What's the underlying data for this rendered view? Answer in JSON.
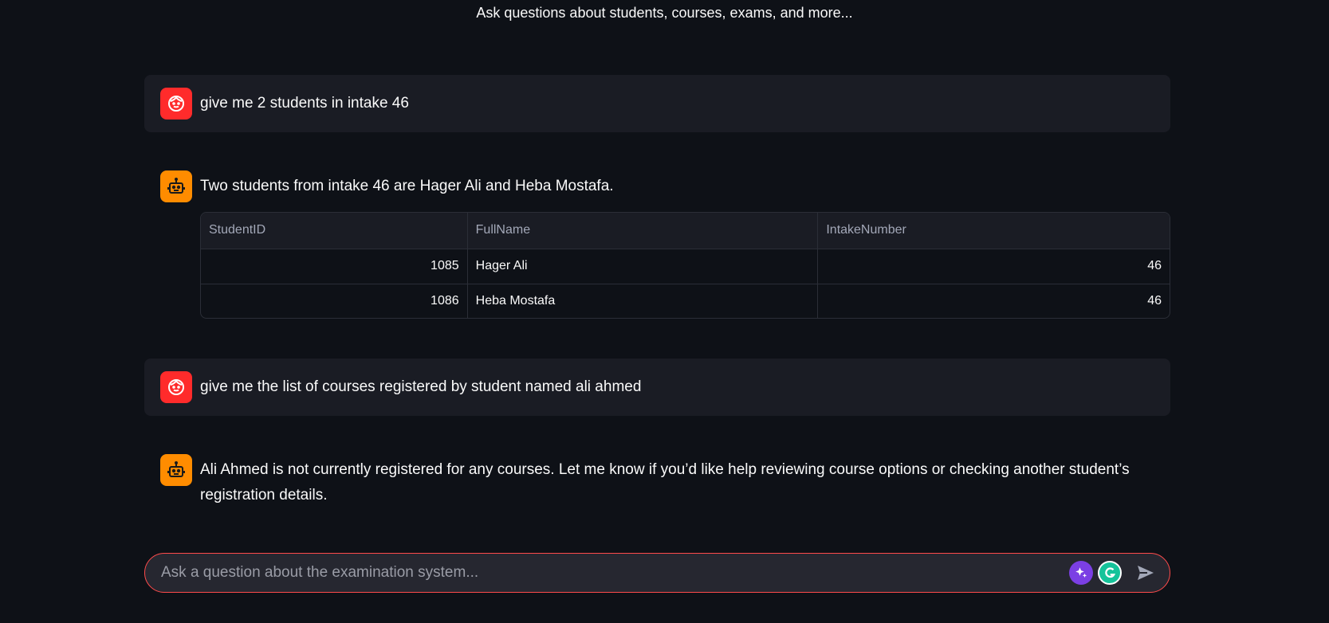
{
  "header": {
    "subtitle": "Ask questions about students, courses, exams, and more..."
  },
  "messages": [
    {
      "role": "user",
      "text": "give me 2 students in intake 46"
    },
    {
      "role": "assistant",
      "text": "Two students from intake 46 are Hager Ali and Heba Mostafa."
    },
    {
      "role": "user",
      "text": "give me the list of courses registered by student named ali ahmed"
    },
    {
      "role": "assistant",
      "text": "Ali Ahmed is not currently registered for any courses. Let me know if you’d like help reviewing course options or checking another student’s registration details."
    }
  ],
  "table": {
    "columns": [
      "StudentID",
      "FullName",
      "IntakeNumber"
    ],
    "rows": [
      [
        "1085",
        "Hager Ali",
        "46"
      ],
      [
        "1086",
        "Heba Mostafa",
        "46"
      ]
    ]
  },
  "chat_input": {
    "placeholder": "Ask a question about the examination system..."
  },
  "colors": {
    "background": "#0e1117",
    "user_avatar": "#ff2b2b",
    "bot_avatar": "#ff8c00",
    "input_border": "#ff4b4b"
  },
  "icons": {
    "user_avatar": "face-icon",
    "bot_avatar": "robot-icon",
    "send": "send-icon",
    "ext1": "sparkle-icon",
    "ext2": "grammarly-icon"
  }
}
